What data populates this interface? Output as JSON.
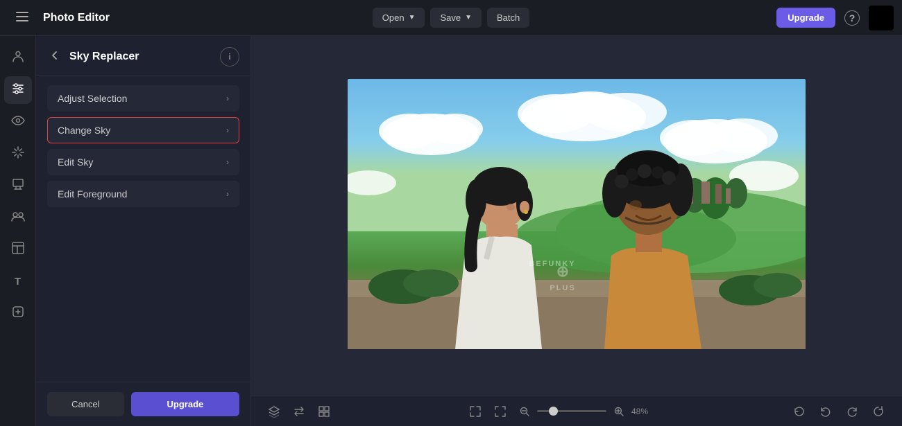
{
  "app": {
    "title": "Photo Editor"
  },
  "topbar": {
    "open_label": "Open",
    "save_label": "Save",
    "batch_label": "Batch",
    "upgrade_label": "Upgrade",
    "help_label": "?"
  },
  "panel": {
    "back_tooltip": "Back",
    "title": "Sky Replacer",
    "info_tooltip": "Info",
    "menu_items": [
      {
        "id": "adjust-selection",
        "label": "Adjust Selection",
        "selected": false
      },
      {
        "id": "change-sky",
        "label": "Change Sky",
        "selected": true
      },
      {
        "id": "edit-sky",
        "label": "Edit Sky",
        "selected": false
      },
      {
        "id": "edit-foreground",
        "label": "Edit Foreground",
        "selected": false
      }
    ],
    "cancel_label": "Cancel",
    "upgrade_label": "Upgrade"
  },
  "bottombar": {
    "zoom_value": "48",
    "zoom_unit": "%",
    "zoom_display": "48%"
  },
  "icons": {
    "hamburger": "☰",
    "person": "👤",
    "sliders": "⚙",
    "eye": "👁",
    "sparkle": "✦",
    "brush": "✏",
    "layers": "❑",
    "group": "⊞",
    "template": "▦",
    "text": "T",
    "badge": "✪",
    "layers_bottom": "⊕",
    "expand": "⤢",
    "fit": "⤡",
    "zoom_minus": "−",
    "zoom_plus": "+",
    "undo_history": "⟲",
    "undo": "↩",
    "redo": "↪",
    "reset": "↺"
  }
}
